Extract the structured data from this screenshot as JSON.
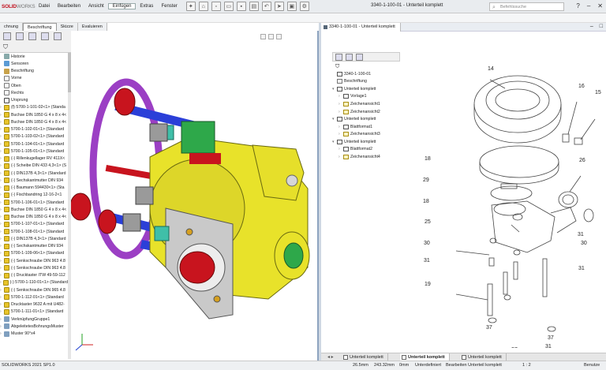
{
  "app": {
    "logo_main": "SOLID",
    "logo_sub": "WORKS",
    "document_title": "3340-1-100-01 - Unterteil komplett",
    "search_placeholder": "Befehlssuche"
  },
  "menu": [
    "Datei",
    "Bearbeiten",
    "Ansicht",
    "Einfügen",
    "Extras",
    "Fenster"
  ],
  "menu_active_index": 3,
  "command_tabs": [
    "chnung",
    "Beschriftung",
    "Skizze",
    "Evaluieren"
  ],
  "command_tab_selected": 1,
  "feature_tree": [
    {
      "label": "Historie",
      "icon": "hist"
    },
    {
      "label": "Sensoren",
      "icon": "sens"
    },
    {
      "label": "Beschriftung",
      "icon": "ann"
    },
    {
      "label": "Vorne",
      "icon": "plane"
    },
    {
      "label": "Oben",
      "icon": "plane"
    },
    {
      "label": "Rechts",
      "icon": "plane"
    },
    {
      "label": "Ursprung",
      "icon": "orig"
    },
    {
      "label": "(f) 5700-1-101-02<1> (Standa",
      "icon": "part"
    },
    {
      "label": "Buchse DIN 1850 G 4 x 8 x 4<",
      "icon": "part"
    },
    {
      "label": "Buchse DIN 1850 G 4 x 8 x 4<",
      "icon": "part"
    },
    {
      "label": "5700-1-102-01<1> (Standard",
      "icon": "part"
    },
    {
      "label": "5700-1-103-02<1> (Standard",
      "icon": "part"
    },
    {
      "label": "5700-1-104-01<1> (Standard",
      "icon": "part"
    },
    {
      "label": "5700-1-105-01<1> (Standard",
      "icon": "part"
    },
    {
      "label": "(-) Rillenkugellager RV 411X<",
      "icon": "part"
    },
    {
      "label": "(-) Scheibe DIN 433 4,3<1> (S",
      "icon": "part"
    },
    {
      "label": "(-) DIN137B 4,3<1> (Standard",
      "icon": "part"
    },
    {
      "label": "(-) Sechskantmutter DIN 934",
      "icon": "part"
    },
    {
      "label": "(-) Baumann 594430<1> (Sta",
      "icon": "part"
    },
    {
      "label": "(-) Fischbandring 12-16-2<1",
      "icon": "part"
    },
    {
      "label": "5700-1-106-01<1> (Standard",
      "icon": "part"
    },
    {
      "label": "Buchse DIN 1850 G 4 x 8 x 4<",
      "icon": "part"
    },
    {
      "label": "Buchse DIN 1850 G 4 x 8 x 4<",
      "icon": "part"
    },
    {
      "label": "5700-1-107-01<1> (Standard",
      "icon": "part"
    },
    {
      "label": "5700-1-108-01<1> (Standard",
      "icon": "part"
    },
    {
      "label": "(-) DIN137B 4,3<1> (Standard",
      "icon": "part"
    },
    {
      "label": "(-) Sechskantmutter DIN 934",
      "icon": "part"
    },
    {
      "label": "5700-1-109-06<1> (Standard",
      "icon": "part"
    },
    {
      "label": "(-) Senkschraube DIN 963 4.8",
      "icon": "part"
    },
    {
      "label": "(-) Senkschraube DIN 963 4.8",
      "icon": "part"
    },
    {
      "label": "(-) Drucktaster ITW 49-59-112",
      "icon": "part"
    },
    {
      "label": "(-) 5700-1-110-01<1> (Standard",
      "icon": "part"
    },
    {
      "label": "(-) Senkschraube DIN 965 4.8",
      "icon": "part"
    },
    {
      "label": "5700-1-112-01<1> (Standard",
      "icon": "part"
    },
    {
      "label": "Drucktaster 9632 A mit U482-",
      "icon": "part"
    },
    {
      "label": "5700-1-111-01<1> (Standard",
      "icon": "part"
    },
    {
      "label": "VerknüpfungGruppe1",
      "icon": "fold"
    },
    {
      "label": "AbgeleitetesBohrungsMuster",
      "icon": "fold"
    },
    {
      "label": "Muster 90°x4",
      "icon": "fold"
    }
  ],
  "drawing_tree": [
    {
      "label": "3340-1-100-01",
      "icon": "sheet",
      "exp": ""
    },
    {
      "label": "Beschriftung",
      "icon": "ann",
      "exp": ""
    },
    {
      "label": "Unterteil komplett",
      "icon": "sheet",
      "exp": "▾"
    },
    {
      "label": "Vorlage1",
      "icon": "sheet",
      "exp": "›"
    },
    {
      "label": "Zeichenansicht1",
      "icon": "view",
      "exp": "›"
    },
    {
      "label": "Zeichenansicht2",
      "icon": "view",
      "exp": "›"
    },
    {
      "label": "Unterteil komplett",
      "icon": "sheet",
      "exp": "▾"
    },
    {
      "label": "Blattformat1",
      "icon": "sheet",
      "exp": "›"
    },
    {
      "label": "Zeichenansicht3",
      "icon": "view",
      "exp": "›"
    },
    {
      "label": "Unterteil komplett",
      "icon": "sheet",
      "exp": "▾"
    },
    {
      "label": "Blattformat2",
      "icon": "sheet",
      "exp": "›"
    },
    {
      "label": "Zeichenansicht4",
      "icon": "view",
      "exp": "›"
    }
  ],
  "balloons": [
    "14",
    "16",
    "15",
    "26",
    "18",
    "29",
    "18",
    "25",
    "30",
    "31",
    "30",
    "31",
    "31",
    "19",
    "37",
    "37",
    "31",
    "37"
  ],
  "sheet_tabs": [
    "Unterteil komplett",
    "Unterteil komplett",
    "Unterteil komplett"
  ],
  "sheet_tab_selected": 1,
  "status": {
    "version": "SOLIDWORKS 2021 SP1.0",
    "x": "26.5mm",
    "y": "243.32mm",
    "z": "0mm",
    "state": "Unterdefiniert",
    "editing": "Bearbeiten Unterteil komplett",
    "scale": "1 : 2",
    "user": "Benutze"
  },
  "colors": {
    "body_yellow": "#e8e22a",
    "ring_purple": "#9b3fc4",
    "red_cap": "#c8141e",
    "blue_rod": "#2b3fd8",
    "teal_block": "#3fbfa8",
    "green_part": "#2ea84a"
  }
}
